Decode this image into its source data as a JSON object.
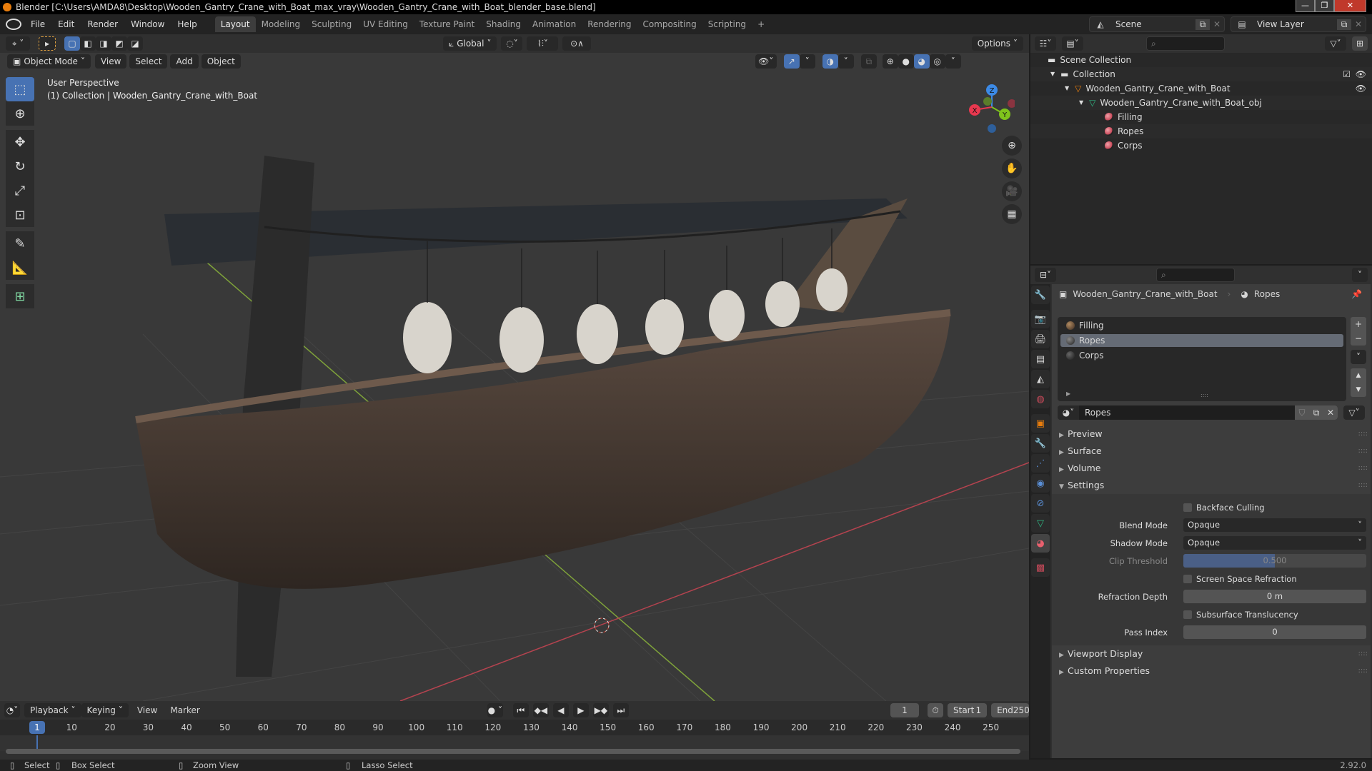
{
  "window": {
    "title": "Blender [C:\\Users\\AMDA8\\Desktop\\Wooden_Gantry_Crane_with_Boat_max_vray\\Wooden_Gantry_Crane_with_Boat_blender_base.blend]",
    "minimize": "—",
    "maximize": "❐",
    "close": "✕"
  },
  "menu": [
    "File",
    "Edit",
    "Render",
    "Window",
    "Help"
  ],
  "workspaces": [
    {
      "label": "Layout",
      "active": true
    },
    {
      "label": "Modeling"
    },
    {
      "label": "Sculpting"
    },
    {
      "label": "UV Editing"
    },
    {
      "label": "Texture Paint"
    },
    {
      "label": "Shading"
    },
    {
      "label": "Animation"
    },
    {
      "label": "Rendering"
    },
    {
      "label": "Compositing"
    },
    {
      "label": "Scripting"
    }
  ],
  "add_workspace": "+",
  "scene": {
    "name": "Scene",
    "view_layer": "View Layer"
  },
  "viewport": {
    "transform_orientation": "Global",
    "options_label": "Options",
    "mode": "Object Mode",
    "menus": [
      "View",
      "Select",
      "Add",
      "Object"
    ],
    "perspective_label": "User Perspective",
    "collection_label": "(1) Collection | Wooden_Gantry_Crane_with_Boat",
    "gizmo_axes": {
      "x": "X",
      "y": "Y",
      "z": "Z"
    },
    "colors": {
      "x": "#e8384f",
      "y": "#7fc31c",
      "z": "#3c8ae6",
      "active_blue": "#4772b3"
    }
  },
  "outliner": {
    "root": "Scene Collection",
    "items": [
      {
        "label": "Collection",
        "type": "collection"
      },
      {
        "label": "Wooden_Gantry_Crane_with_Boat",
        "type": "object"
      },
      {
        "label": "Wooden_Gantry_Crane_with_Boat_obj",
        "type": "mesh"
      },
      {
        "label": "Filling",
        "type": "material"
      },
      {
        "label": "Ropes",
        "type": "material"
      },
      {
        "label": "Corps",
        "type": "material"
      }
    ]
  },
  "properties": {
    "breadcrumb_object": "Wooden_Gantry_Crane_with_Boat",
    "breadcrumb_material": "Ropes",
    "material_slots": [
      {
        "label": "Filling"
      },
      {
        "label": "Ropes",
        "selected": true
      },
      {
        "label": "Corps"
      }
    ],
    "material_name": "Ropes",
    "sections": {
      "preview": "Preview",
      "surface": "Surface",
      "volume": "Volume",
      "settings": "Settings",
      "viewport_display": "Viewport Display",
      "custom_properties": "Custom Properties"
    },
    "settings": {
      "backface_culling": {
        "label": "Backface Culling",
        "checked": false
      },
      "blend_mode": {
        "label": "Blend Mode",
        "value": "Opaque"
      },
      "shadow_mode": {
        "label": "Shadow Mode",
        "value": "Opaque"
      },
      "clip_threshold": {
        "label": "Clip Threshold",
        "value": "0.500",
        "fraction": 0.5
      },
      "screen_space_refraction": {
        "label": "Screen Space Refraction",
        "checked": false
      },
      "refraction_depth": {
        "label": "Refraction Depth",
        "value": "0 m"
      },
      "subsurface_translucency": {
        "label": "Subsurface Translucency",
        "checked": false
      },
      "pass_index": {
        "label": "Pass Index",
        "value": "0"
      }
    }
  },
  "timeline": {
    "menus": [
      "Playback",
      "Keying",
      "View",
      "Marker"
    ],
    "current_frame": "1",
    "start_label": "Start",
    "start": "1",
    "end_label": "End",
    "end": "250",
    "ticks": [
      "10",
      "20",
      "30",
      "40",
      "50",
      "60",
      "70",
      "80",
      "90",
      "100",
      "110",
      "120",
      "130",
      "140",
      "150",
      "160",
      "170",
      "180",
      "190",
      "200",
      "210",
      "220",
      "230",
      "240",
      "250"
    ],
    "playhead": "1"
  },
  "status": {
    "select": "Select",
    "box_select": "Box Select",
    "zoom_view": "Zoom View",
    "lasso_select": "Lasso Select",
    "version": "2.92.0"
  }
}
